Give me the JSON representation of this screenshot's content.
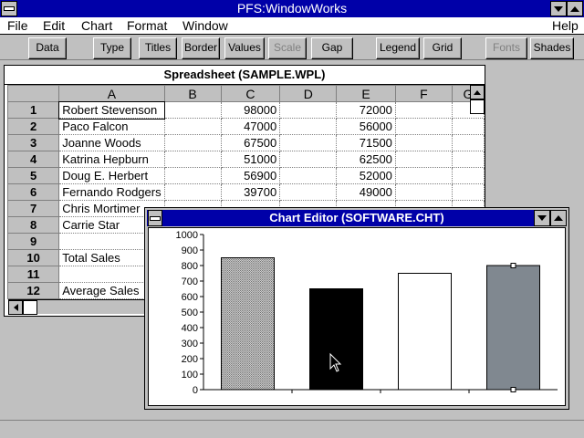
{
  "app": {
    "title": "PFS:WindowWorks"
  },
  "menu": [
    "File",
    "Edit",
    "Chart",
    "Format",
    "Window",
    "Help"
  ],
  "toolbar": {
    "buttons": [
      {
        "label": "Data",
        "enabled": true
      },
      {
        "label": "Type",
        "enabled": true
      },
      {
        "label": "Titles",
        "enabled": true
      },
      {
        "label": "Border",
        "enabled": true
      },
      {
        "label": "Values",
        "enabled": true
      },
      {
        "label": "Scale",
        "enabled": false
      },
      {
        "label": "Gap",
        "enabled": true
      },
      {
        "label": "Legend",
        "enabled": true
      },
      {
        "label": "Grid",
        "enabled": true
      },
      {
        "label": "Fonts",
        "enabled": false
      },
      {
        "label": "Shades",
        "enabled": true
      }
    ]
  },
  "spreadsheet": {
    "title": "Spreadsheet (SAMPLE.WPL)",
    "columns": [
      "A",
      "B",
      "C",
      "D",
      "E",
      "F",
      "G"
    ],
    "rows": [
      {
        "n": "1",
        "a": "Robert Stevenson",
        "c": "98000",
        "e": "72000"
      },
      {
        "n": "2",
        "a": "Paco Falcon",
        "c": "47000",
        "e": "56000"
      },
      {
        "n": "3",
        "a": "Joanne Woods",
        "c": "67500",
        "e": "71500"
      },
      {
        "n": "4",
        "a": "Katrina Hepburn",
        "c": "51000",
        "e": "62500"
      },
      {
        "n": "5",
        "a": "Doug E. Herbert",
        "c": "56900",
        "e": "52000"
      },
      {
        "n": "6",
        "a": "Fernando Rodgers",
        "c": "39700",
        "e": "49000"
      },
      {
        "n": "7",
        "a": "Chris Mortimer",
        "c": "",
        "e": ""
      },
      {
        "n": "8",
        "a": "Carrie Star",
        "c": "",
        "e": ""
      },
      {
        "n": "9",
        "a": "",
        "c": "",
        "e": ""
      },
      {
        "n": "10",
        "a": "Total Sales",
        "c": "",
        "e": ""
      },
      {
        "n": "11",
        "a": "",
        "c": "",
        "e": ""
      },
      {
        "n": "12",
        "a": "Average Sales",
        "c": "",
        "e": ""
      }
    ]
  },
  "chart_editor": {
    "title": "Chart Editor (SOFTWARE.CHT)"
  },
  "chart_data": {
    "type": "bar",
    "categories": [
      "",
      "",
      "",
      ""
    ],
    "values": [
      850,
      650,
      750,
      800
    ],
    "fills": [
      "#b8b8b8",
      "#000000",
      "#ffffff",
      "#808890"
    ],
    "ylim": [
      0,
      1000
    ],
    "yticks": [
      "0",
      "100",
      "200",
      "300",
      "400",
      "500",
      "600",
      "700",
      "800",
      "900",
      "1000"
    ],
    "grid": false
  }
}
